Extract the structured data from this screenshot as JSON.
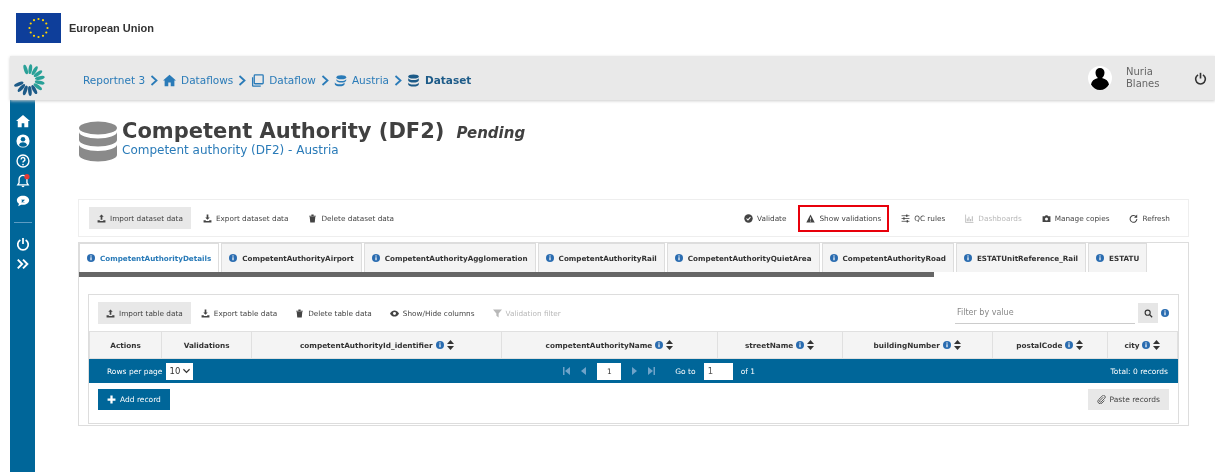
{
  "header": {
    "org_name": "European Union"
  },
  "breadcrumb": [
    {
      "label": "Reportnet 3",
      "current": false
    },
    {
      "label": "Dataflows",
      "current": false
    },
    {
      "label": "Dataflow",
      "current": false
    },
    {
      "label": "Austria",
      "current": false
    },
    {
      "label": "Dataset",
      "current": true
    }
  ],
  "user": {
    "first_name": "Nuria",
    "last_name": "Blanes"
  },
  "sidebar": {
    "notification_badge": true
  },
  "page": {
    "title": "Competent Authority (DF2)",
    "status": "Pending",
    "subtitle": "Competent authority (DF2) - Austria"
  },
  "dataset_toolbar": {
    "left": [
      {
        "label": "Import dataset data",
        "active": true,
        "disabled": false
      },
      {
        "label": "Export dataset data",
        "active": false,
        "disabled": false
      },
      {
        "label": "Delete dataset data",
        "active": false,
        "disabled": false
      }
    ],
    "right": [
      {
        "label": "Validate",
        "disabled": false,
        "highlighted": false
      },
      {
        "label": "Show validations",
        "disabled": false,
        "highlighted": true
      },
      {
        "label": "QC rules",
        "disabled": false,
        "highlighted": false
      },
      {
        "label": "Dashboards",
        "disabled": true,
        "highlighted": false
      },
      {
        "label": "Manage copies",
        "disabled": false,
        "highlighted": false
      },
      {
        "label": "Refresh",
        "disabled": false,
        "highlighted": false
      }
    ]
  },
  "tabs": [
    {
      "label": "CompetentAuthorityDetails",
      "selected": true
    },
    {
      "label": "CompetentAuthorityAirport",
      "selected": false
    },
    {
      "label": "CompetentAuthorityAgglomeration",
      "selected": false
    },
    {
      "label": "CompetentAuthorityRail",
      "selected": false
    },
    {
      "label": "CompetentAuthorityQuietArea",
      "selected": false
    },
    {
      "label": "CompetentAuthorityRoad",
      "selected": false
    },
    {
      "label": "ESTATUnitReference_Rail",
      "selected": false
    },
    {
      "label": "ESTATU",
      "selected": false
    }
  ],
  "table_toolbar": {
    "buttons": [
      {
        "label": "Import table data",
        "active": true,
        "disabled": false
      },
      {
        "label": "Export table data",
        "active": false,
        "disabled": false
      },
      {
        "label": "Delete table data",
        "active": false,
        "disabled": false
      },
      {
        "label": "Show/Hide columns",
        "active": false,
        "disabled": false
      },
      {
        "label": "Validation filter",
        "active": false,
        "disabled": true
      }
    ],
    "filter": {
      "placeholder": "Filter by value"
    }
  },
  "table": {
    "columns": [
      {
        "label": "Actions",
        "info": false,
        "sortable": false
      },
      {
        "label": "Validations",
        "info": false,
        "sortable": false
      },
      {
        "label": "competentAuthorityId_identifier",
        "info": true,
        "sortable": true
      },
      {
        "label": "competentAuthorityName",
        "info": true,
        "sortable": true
      },
      {
        "label": "streetName",
        "info": true,
        "sortable": true
      },
      {
        "label": "buildingNumber",
        "info": true,
        "sortable": true
      },
      {
        "label": "postalCode",
        "info": true,
        "sortable": true
      },
      {
        "label": "city",
        "info": true,
        "sortable": true
      }
    ]
  },
  "paginator": {
    "rows_label": "Rows per page",
    "rows_value": "10",
    "page": "1",
    "goto_label": "Go to",
    "goto_value": "1",
    "of_pages": "of 1",
    "total": "Total: 0 records"
  },
  "actions": {
    "add": "Add record",
    "paste": "Paste records"
  }
}
